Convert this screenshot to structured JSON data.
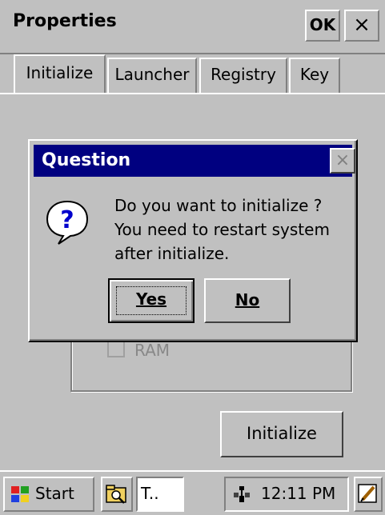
{
  "app": {
    "title": "Properties",
    "ok_label": "OK",
    "close_label": "×"
  },
  "tabs": [
    {
      "label": "Initialize",
      "selected": true
    },
    {
      "label": "Launcher",
      "selected": false
    },
    {
      "label": "Registry",
      "selected": false
    },
    {
      "label": "Key",
      "selected": false
    }
  ],
  "panel": {
    "ram_label": "RAM",
    "ram_checked": false,
    "initialize_button": "Initialize"
  },
  "dialog": {
    "title": "Question",
    "close_label": "×",
    "icon": "question-icon",
    "message_lines": [
      "Do you want to initialize ?",
      "You need to restart system",
      "after initialize."
    ],
    "yes_label": "Yes",
    "no_label": "No"
  },
  "taskbar": {
    "start_label": "Start",
    "task_label": "T..",
    "clock": "12:11 PM"
  },
  "colors": {
    "face": "#c0c0c0",
    "titlebar_active": "#000080",
    "highlight": "#ffffff",
    "shadow": "#808080"
  }
}
